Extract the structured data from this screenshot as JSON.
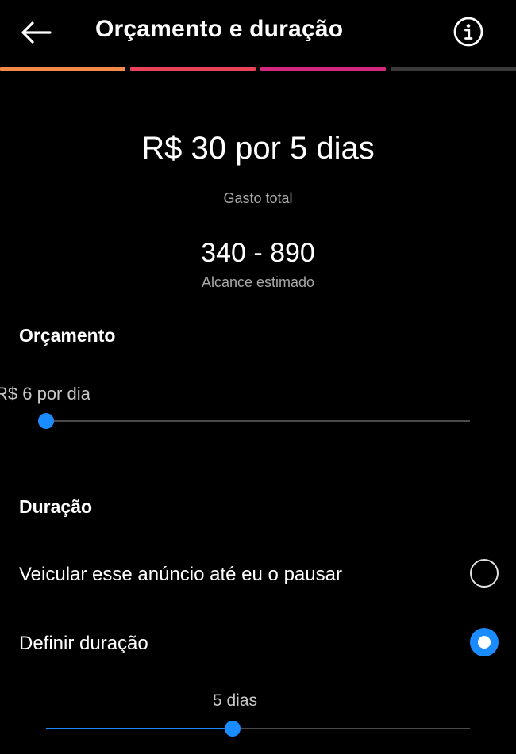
{
  "header": {
    "title": "Orçamento e duração",
    "back_icon": "arrow-left-icon",
    "info_icon": "info-circle-icon"
  },
  "progress": {
    "segments": [
      {
        "color": "#f5894a"
      },
      {
        "color": "#e9435a"
      },
      {
        "color": "#d3287f"
      },
      {
        "color": "#3a3a3a"
      }
    ],
    "completed_steps": 3,
    "total_steps": 4
  },
  "summary": {
    "amount": "R$ 30 por 5 dias",
    "amount_label": "Gasto total",
    "reach": "340 - 890",
    "reach_label": "Alcance estimado"
  },
  "budget": {
    "title": "Orçamento",
    "value_label": "R$ 6 por dia",
    "slider_fraction": 0
  },
  "duration": {
    "title": "Duração",
    "options": [
      {
        "label": "Veicular esse anúncio até eu o pausar",
        "selected": false
      },
      {
        "label": "Definir duração",
        "selected": true
      }
    ],
    "days_label": "5 dias",
    "slider_fraction": 0.44
  },
  "colors": {
    "accent": "#1a8cff",
    "background": "#000000",
    "text": "#ffffff",
    "muted": "#a8a8a8"
  }
}
